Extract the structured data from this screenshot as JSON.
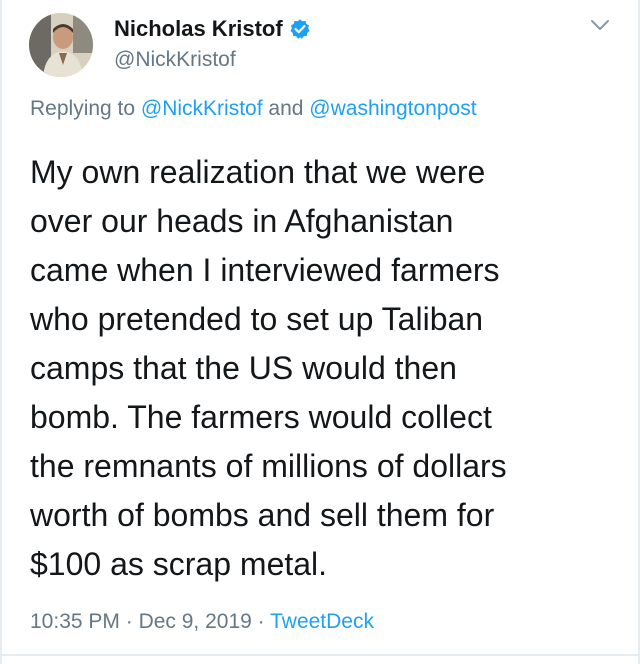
{
  "author": {
    "name": "Nicholas Kristof",
    "handle": "@NickKristof",
    "verified": true,
    "avatar": "avatar-photo"
  },
  "icons": {
    "verified": "verified-badge-icon",
    "menu": "chevron-down-icon"
  },
  "reply": {
    "prefix": "Replying to ",
    "mention_1": "@NickKristof",
    "joiner": " and ",
    "mention_2": "@washingtonpost"
  },
  "tweet": {
    "lines": [
      "My own realization that we were",
      "over our heads in Afghanistan",
      "came when I interviewed farmers",
      "who pretended to set up Taliban",
      "camps that the US would then",
      "bomb. The farmers would collect",
      "the remnants of millions of dollars",
      "worth of bombs and sell them for",
      "$100 as scrap metal."
    ]
  },
  "meta": {
    "time": "10:35 PM",
    "separator_1": " · ",
    "date": "Dec 9, 2019",
    "separator_2": " · ",
    "source": "TweetDeck"
  },
  "colors": {
    "text": "#14171a",
    "secondary": "#657786",
    "link": "#1da1f2",
    "border": "#e6ecf0"
  }
}
